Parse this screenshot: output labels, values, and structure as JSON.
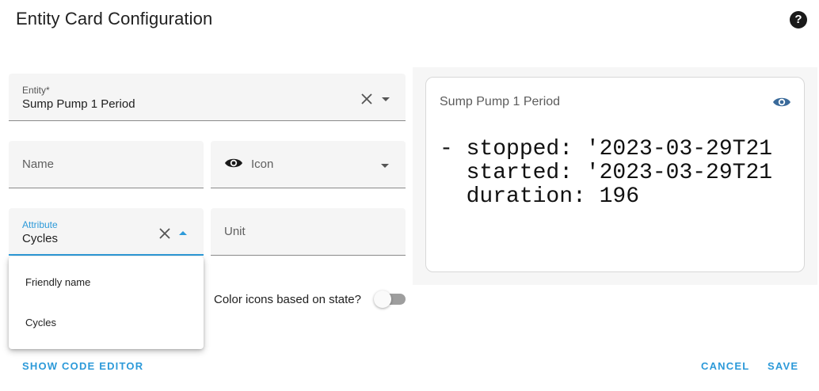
{
  "dialog": {
    "title": "Entity Card Configuration"
  },
  "form": {
    "entity": {
      "label": "Entity*",
      "value": "Sump Pump 1 Period"
    },
    "name": {
      "placeholder": "Name"
    },
    "icon": {
      "placeholder": "Icon"
    },
    "attribute": {
      "label": "Attribute",
      "value": "Cycles"
    },
    "unit": {
      "placeholder": "Unit"
    },
    "attribute_menu": [
      {
        "label": "Friendly name"
      },
      {
        "label": "Cycles"
      }
    ],
    "color_toggle": {
      "label": "Color icons based on state?",
      "on": false
    }
  },
  "preview": {
    "card_title": "Sump Pump 1 Period",
    "code_lines": [
      "- stopped: '2023-03-29T21",
      "  started: '2023-03-29T21",
      "  duration: 196"
    ]
  },
  "footer": {
    "code_editor_label": "SHOW CODE EDITOR",
    "cancel_label": "CANCEL",
    "save_label": "SAVE"
  },
  "colors": {
    "accent": "#2d9ad9",
    "eye_icon": "#3a6a9a"
  }
}
